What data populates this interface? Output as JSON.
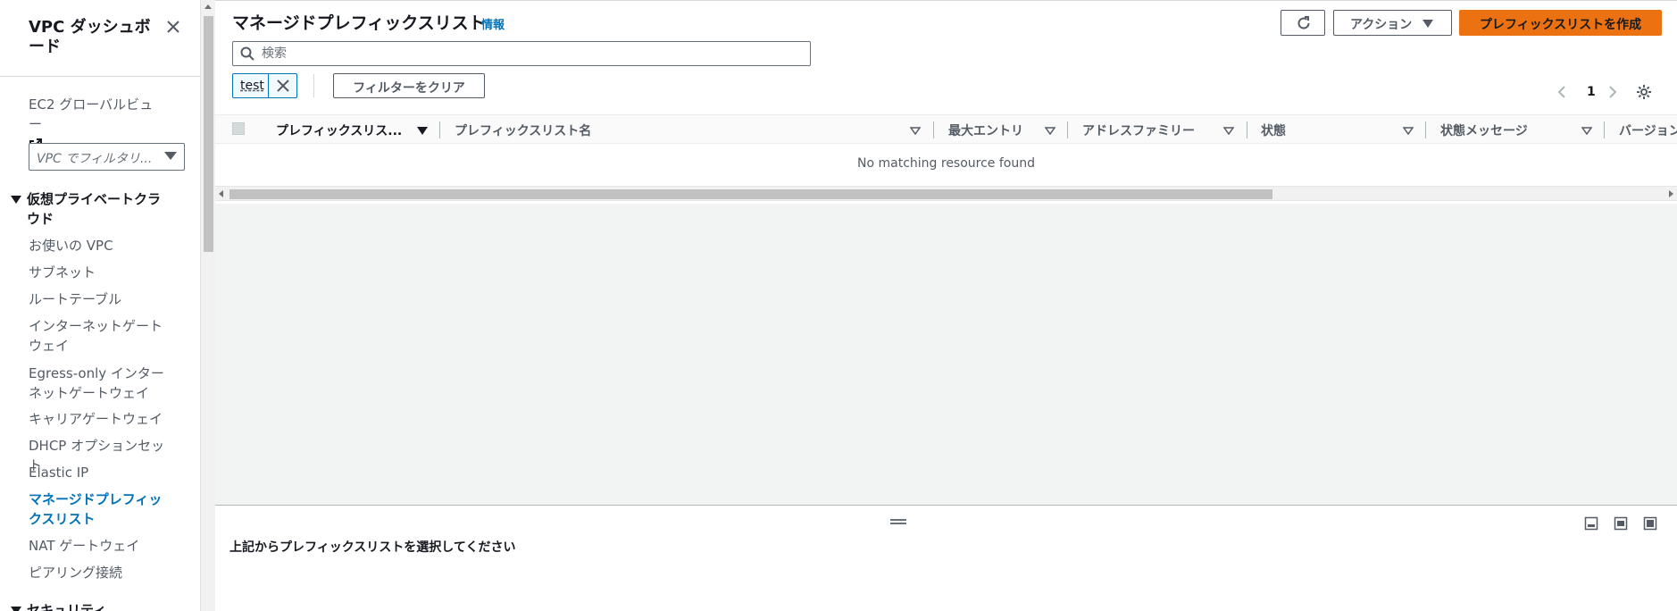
{
  "sidebar": {
    "title": "VPC ダッシュボード",
    "ec2_link": "EC2 グローバルビュー",
    "filter_placeholder": "VPC でフィルタリ...",
    "section_title": "仮想プライベートクラウド",
    "items": [
      {
        "label": "お使いの VPC"
      },
      {
        "label": "サブネット"
      },
      {
        "label": "ルートテーブル"
      },
      {
        "label": "インターネットゲートウェイ"
      },
      {
        "label": "Egress-only インターネットゲートウェイ"
      },
      {
        "label": "キャリアゲートウェイ"
      },
      {
        "label": "DHCP オプションセット"
      },
      {
        "label": "Elastic IP"
      },
      {
        "label": "マネージドプレフィックスリスト",
        "active": true
      },
      {
        "label": "NAT ゲートウェイ"
      },
      {
        "label": "ピアリング接続"
      }
    ],
    "next_section_title": "セキュリティ"
  },
  "header": {
    "title": "マネージドプレフィックスリスト",
    "info_link": "情報",
    "actions_label": "アクション",
    "create_label": "プレフィックスリストを作成"
  },
  "search": {
    "placeholder": "検索",
    "value": ""
  },
  "filter": {
    "token": "test",
    "clear_label": "フィルターをクリア"
  },
  "pagination": {
    "current_page": "1"
  },
  "table": {
    "columns": [
      {
        "label": "プレフィックスリス...",
        "sorted": true
      },
      {
        "label": "プレフィックスリスト名"
      },
      {
        "label": "最大エントリ"
      },
      {
        "label": "アドレスファミリー"
      },
      {
        "label": "状態"
      },
      {
        "label": "状態メッセージ"
      },
      {
        "label": "バージョン"
      }
    ],
    "empty_message": "No matching resource found"
  },
  "detail_panel": {
    "message": "上記からプレフィックスリストを選択してください"
  },
  "colors": {
    "accent": "#ec7211",
    "link": "#0073bb",
    "text": "#16191f",
    "muted": "#545b64"
  }
}
